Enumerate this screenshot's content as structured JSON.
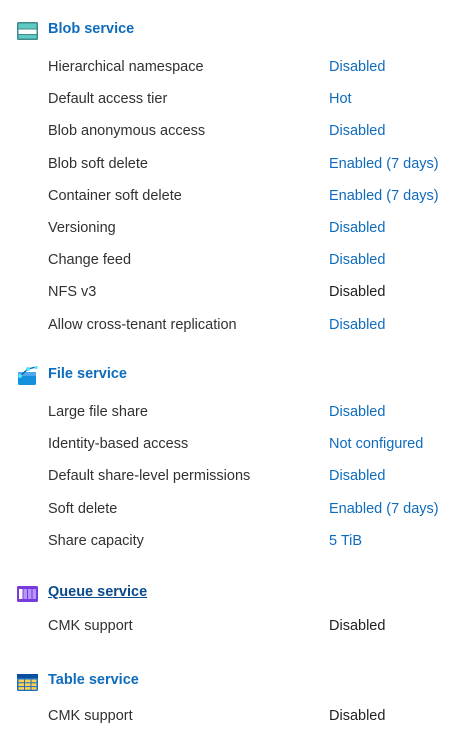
{
  "colors": {
    "link": "#0f6cbd",
    "text": "#323130",
    "static_value": "#201f1e"
  },
  "blob": {
    "title": "Blob service",
    "icon": "blob-storage-icon",
    "rows": [
      {
        "label": "Hierarchical namespace",
        "value": "Disabled",
        "link": true
      },
      {
        "label": "Default access tier",
        "value": "Hot",
        "link": true
      },
      {
        "label": "Blob anonymous access",
        "value": "Disabled",
        "link": true
      },
      {
        "label": "Blob soft delete",
        "value": "Enabled (7 days)",
        "link": true
      },
      {
        "label": "Container soft delete",
        "value": "Enabled (7 days)",
        "link": true
      },
      {
        "label": "Versioning",
        "value": "Disabled",
        "link": true
      },
      {
        "label": "Change feed",
        "value": "Disabled",
        "link": true
      },
      {
        "label": "NFS v3",
        "value": "Disabled",
        "link": false
      },
      {
        "label": "Allow cross-tenant replication",
        "value": "Disabled",
        "link": true
      }
    ]
  },
  "file": {
    "title": "File service",
    "icon": "file-share-icon",
    "rows": [
      {
        "label": "Large file share",
        "value": "Disabled",
        "link": true
      },
      {
        "label": "Identity-based access",
        "value": "Not configured",
        "link": true
      },
      {
        "label": "Default share-level permissions",
        "value": "Disabled",
        "link": true
      },
      {
        "label": "Soft delete",
        "value": "Enabled (7 days)",
        "link": true
      },
      {
        "label": "Share capacity",
        "value": "5 TiB",
        "link": true
      }
    ]
  },
  "queue": {
    "title": "Queue service",
    "icon": "queue-icon",
    "rows": [
      {
        "label": "CMK support",
        "value": "Disabled",
        "link": false
      }
    ]
  },
  "table": {
    "title": "Table service",
    "icon": "table-icon",
    "rows": [
      {
        "label": "CMK support",
        "value": "Disabled",
        "link": false
      }
    ]
  }
}
